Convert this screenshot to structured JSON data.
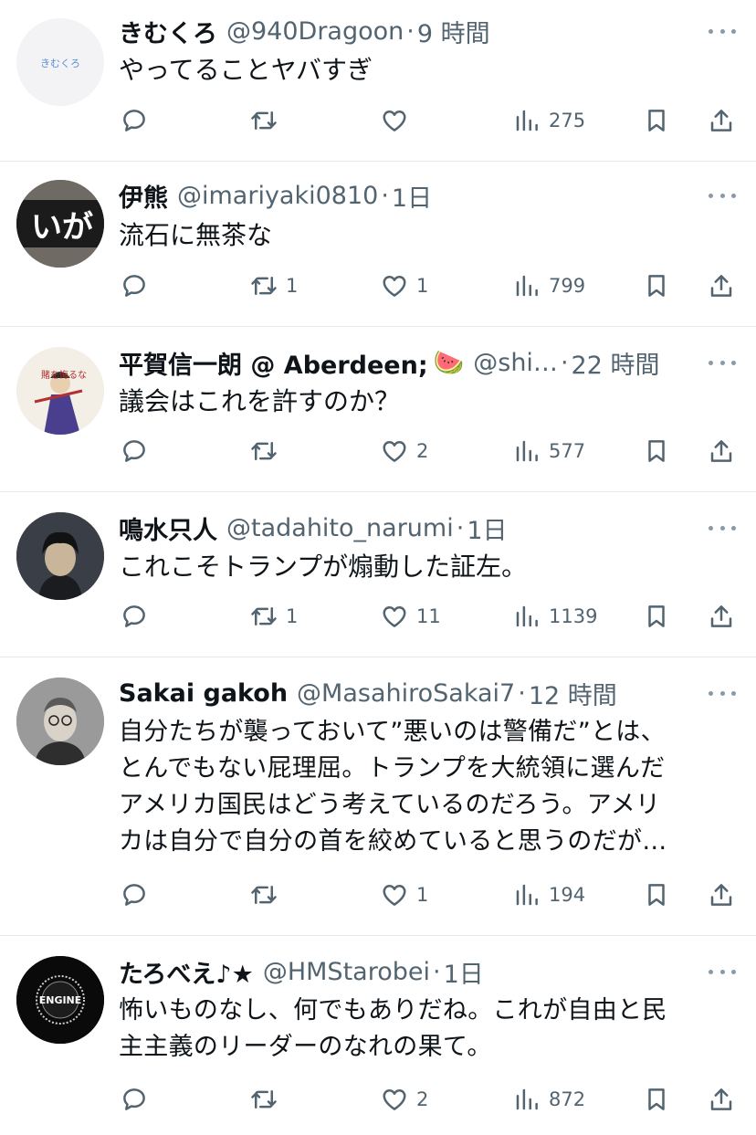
{
  "tweets": [
    {
      "name": "きむくろ",
      "handle": "@940Dragoon",
      "time": "9 時間",
      "avatar_text": "きむくろ",
      "text": "やってることヤバすぎ",
      "replies": "",
      "retweets": "",
      "likes": "",
      "views": "275"
    },
    {
      "name": "伊熊",
      "handle": "@imariyaki0810",
      "time": "1日",
      "avatar_text": "いが",
      "text": "流石に無茶な",
      "replies": "",
      "retweets": "1",
      "likes": "1",
      "views": "799"
    },
    {
      "name": "平賀信一朗 @ Aberdeen;",
      "emoji": "🍉",
      "handle": "@shi…",
      "time": "22 時間",
      "avatar_text": "賭を悔るな",
      "text": "議会はこれを許すのか？",
      "replies": "",
      "retweets": "",
      "likes": "2",
      "views": "577"
    },
    {
      "name": "鳴水只人",
      "handle": "@tadahito_narumi",
      "time": "1日",
      "text": "これこそトランプが煽動した証左。",
      "replies": "",
      "retweets": "1",
      "likes": "11",
      "views": "1139"
    },
    {
      "name": "Sakai gakoh",
      "handle": "@MasahiroSakai7",
      "time": "12 時間",
      "text": "自分たちが襲っておいて”悪いのは警備だ”とは、\nとんでもない屁理屈。トランプを大統領に選んだ\nアメリカ国民はどう考えているのだろう。アメリ\nカは自分で自分の首を絞めていると思うのだが…",
      "replies": "",
      "retweets": "",
      "likes": "1",
      "views": "194"
    },
    {
      "name": "たろべえ♪★",
      "handle": "@HMStarobei",
      "time": "1日",
      "avatar_text": "ENGINE",
      "text": "怖いものなし、何でもありだね。これが自由と民\n主主義のリーダーのなれの果て。",
      "replies": "",
      "retweets": "",
      "likes": "2",
      "views": "872"
    }
  ]
}
